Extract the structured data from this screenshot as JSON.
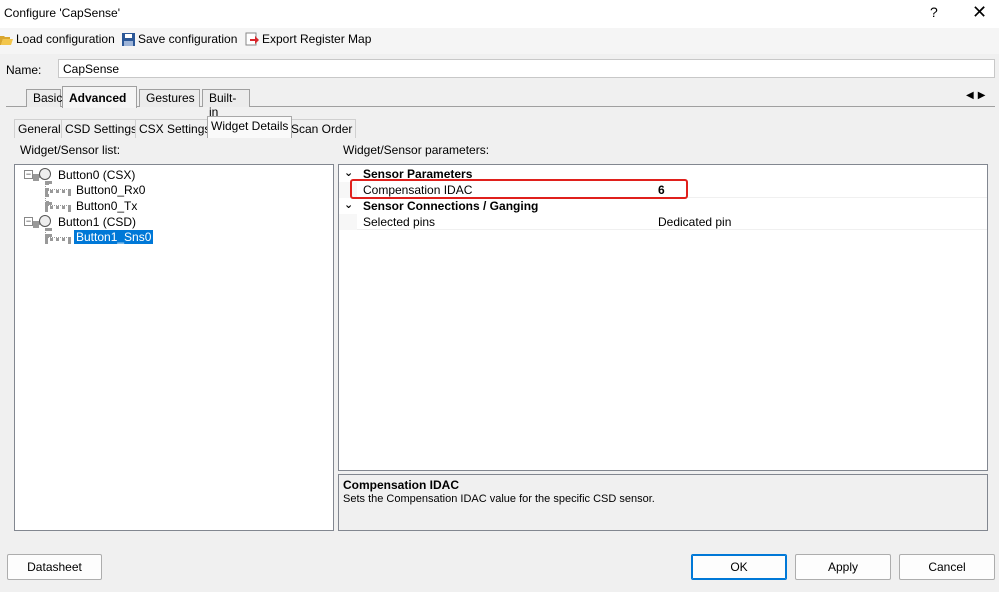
{
  "window": {
    "title": "Configure 'CapSense'",
    "help_glyph": "?",
    "close_glyph": "✕"
  },
  "toolbar": {
    "load_label": "Load configuration",
    "save_label": "Save configuration",
    "export_label": "Export Register Map"
  },
  "name_field": {
    "label": "Name:",
    "value": "CapSense"
  },
  "main_tabs": [
    {
      "label": "Basic"
    },
    {
      "label": "Advanced"
    },
    {
      "label": "Gestures"
    },
    {
      "label": "Built-in"
    }
  ],
  "sub_tabs": [
    {
      "label": "General"
    },
    {
      "label": "CSD Settings"
    },
    {
      "label": "CSX Settings"
    },
    {
      "label": "Widget Details"
    },
    {
      "label": "Scan Order"
    }
  ],
  "left_panel": {
    "title": "Widget/Sensor list:",
    "tree": [
      {
        "label": "Button0 (CSX)"
      },
      {
        "label": "Button0_Rx0"
      },
      {
        "label": "Button0_Tx"
      },
      {
        "label": "Button1 (CSD)"
      },
      {
        "label": "Button1_Sns0"
      }
    ]
  },
  "right_panel": {
    "title": "Widget/Sensor parameters:",
    "categories": [
      {
        "label": "Sensor Parameters",
        "properties": [
          {
            "name": "Compensation IDAC",
            "value": "6"
          }
        ]
      },
      {
        "label": "Sensor Connections / Ganging",
        "properties": [
          {
            "name": "Selected pins",
            "value": "Dedicated pin"
          }
        ]
      }
    ],
    "description": {
      "title": "Compensation IDAC",
      "text": "Sets the Compensation IDAC value for the specific CSD sensor."
    }
  },
  "buttons": {
    "datasheet": "Datasheet",
    "ok": "OK",
    "apply": "Apply",
    "cancel": "Cancel"
  },
  "colors": {
    "selection": "#0078d7",
    "highlight": "#e0201c"
  }
}
